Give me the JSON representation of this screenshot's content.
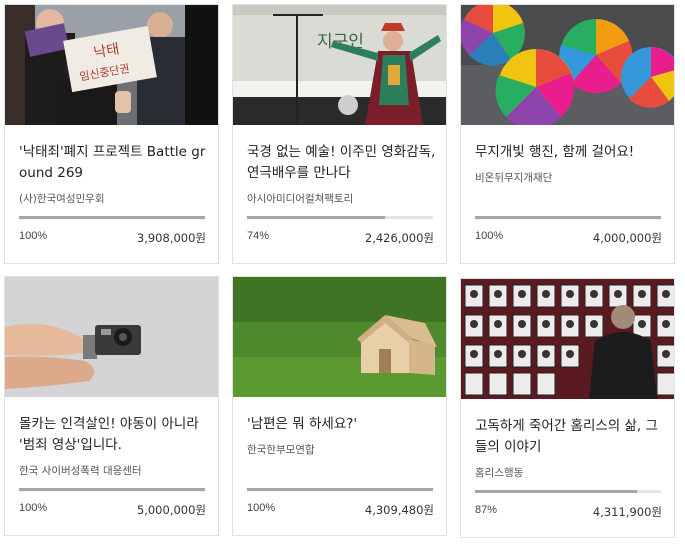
{
  "cards": [
    {
      "title": "'낙태죄'폐지 프로젝트 Battle ground 269",
      "org": "(사)한국여성민우회",
      "percent": "100%",
      "percent_value": 100,
      "amount": "3,908,000원",
      "image": "protest-sign-photo",
      "sign_text": [
        "낙태",
        "임신중단권"
      ]
    },
    {
      "title": "국경 없는 예술! 이주민 영화감독, 연극배우를 만나다",
      "org": "아시아미디어컬쳐팩토리",
      "percent": "74%",
      "percent_value": 74,
      "amount": "2,426,000원",
      "image": "stage-performer-photo",
      "banner_text": "지구인"
    },
    {
      "title": "무지개빛 행진, 함께 걸어요!",
      "org": "비온뒤무지개재단",
      "percent": "100%",
      "percent_value": 100,
      "amount": "4,000,000원",
      "image": "rainbow-umbrellas-photo"
    },
    {
      "title": "몰카는 인격살인! 야동이 아니라 '범죄 영상'입니다.",
      "org": "한국 사이버성폭력 대응센터",
      "percent": "100%",
      "percent_value": 100,
      "amount": "5,000,000원",
      "image": "hidden-camera-photo"
    },
    {
      "title": "'남편은 뭐 하세요?'",
      "org": "한국한부모연합",
      "percent": "100%",
      "percent_value": 100,
      "amount": "4,309,480원",
      "image": "toy-house-on-grass-photo"
    },
    {
      "title": "고독하게 죽어간 홈리스의 삶, 그들의 이야기",
      "org": "홈리스행동",
      "percent": "87%",
      "percent_value": 87,
      "amount": "4,311,900원",
      "image": "memorial-portraits-photo"
    }
  ]
}
